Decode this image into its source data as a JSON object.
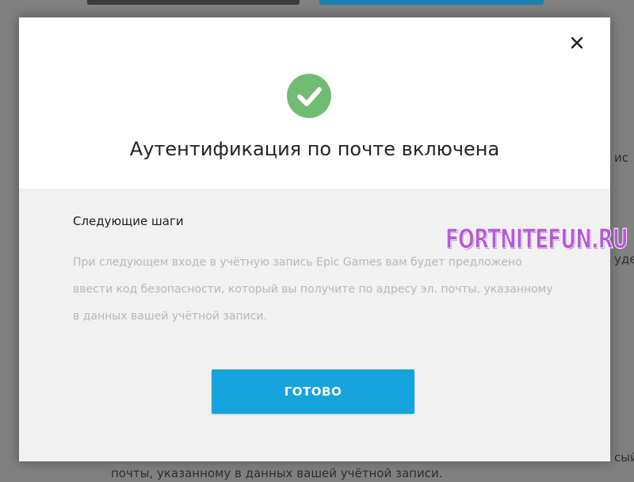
{
  "modal": {
    "title": "Аутентификация по почте включена",
    "next_steps_title": "Следующие шаги",
    "next_steps_lines": [
      "При следующем входе в учётную запись Epic Games вам будет предложено",
      "ввести код безопасности, который вы получите по адресу эл. почты, указанному",
      "в данных вашей учётной записи."
    ],
    "done_label": "ГОТОВО"
  },
  "background": {
    "bottom_text": "почты, указанному в данных вашей учётной записи.",
    "right_fragments": [
      "ис",
      "уде",
      "сый"
    ]
  },
  "watermark": "FORTNITEFUN.RU",
  "colors": {
    "accent": "#17a3dd",
    "success": "#71bc73"
  },
  "icons": {
    "close": "close-icon",
    "success": "checkmark-icon"
  }
}
